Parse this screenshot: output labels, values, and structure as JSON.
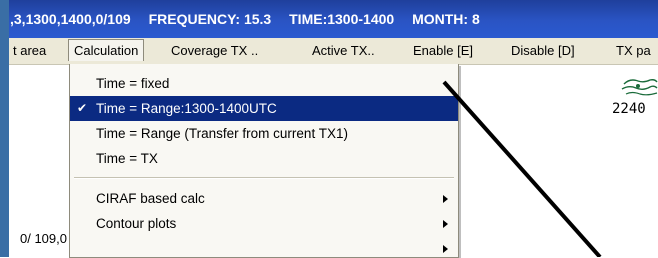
{
  "titlebar": {
    "segments": [
      ",3,1300,1400,0/109",
      "FREQUENCY: 15.3",
      "TIME:1300-1400",
      "MONTH: 8"
    ]
  },
  "menubar": {
    "items": [
      "t area",
      "Calculation",
      "Coverage TX ..",
      "Active TX..",
      "Enable [E]",
      "Disable [D]",
      "TX pa"
    ]
  },
  "dropdown": {
    "items": [
      {
        "label": "Time = fixed",
        "checked": false
      },
      {
        "label": "Time = Range:1300-1400UTC",
        "checked": true
      },
      {
        "label": "Time = Range (Transfer from current TX1)",
        "checked": false
      },
      {
        "label": "Time = TX",
        "checked": false
      }
    ],
    "submenus": [
      {
        "label": "CIRAF based calc"
      },
      {
        "label": "Contour plots"
      }
    ],
    "check_glyph": "✔"
  },
  "content": {
    "coord_text": "0/ 109,0",
    "map_label": "2240"
  },
  "colors": {
    "title_bg": "#2a54c4",
    "menu_bg": "#ece9d8",
    "highlight": "#0b2a82"
  }
}
